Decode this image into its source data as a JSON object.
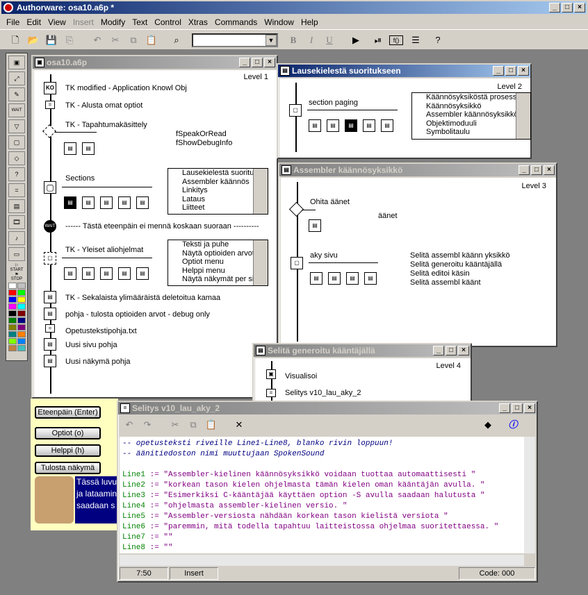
{
  "app": {
    "title": "Authorware: osa10.a6p *"
  },
  "menu": [
    "File",
    "Edit",
    "View",
    "Insert",
    "Modify",
    "Text",
    "Control",
    "Xtras",
    "Commands",
    "Window",
    "Help"
  ],
  "toolbar": {
    "font_select": "",
    "bold": "B",
    "italic": "I",
    "underline": "U"
  },
  "palette": {
    "start_label": "START",
    "stop_label": "STOP",
    "colors": [
      "#ffffff",
      "#c0c0c0",
      "#ff0000",
      "#00ff00",
      "#0000ff",
      "#ffff00",
      "#ff00ff",
      "#00ffff",
      "#000000",
      "#800000",
      "#008000",
      "#000080",
      "#808000",
      "#800080",
      "#008080",
      "#ff8000",
      "#80ff00",
      "#0080ff",
      "#c08040",
      "#40c0c0"
    ]
  },
  "win_main": {
    "title": "osa10.a6p",
    "level": "Level 1",
    "nodes": [
      "TK modified - Application Knowl Obj",
      "TK - Alusta omat optiot",
      "TK - Tapahtumakäsittely",
      "Sections",
      "------ Tästä eteenpäin ei mennä koskaan suoraan ----------",
      "TK - Yleiset aliohjelmat",
      "TK - Sekalaista ylimääräistä deletoitua kamaa",
      "pohja - tulosta optioiden arvot - debug only",
      "Opetustekstipohja.txt",
      "Uusi sivu pohja",
      "Uusi näkymä pohja"
    ],
    "funcs": [
      "fSpeakOrRead",
      "fShowDebugInfo"
    ],
    "list1": [
      "Lausekielestä suorituksee",
      "Assembler käännös",
      "Linkitys",
      "Lataus",
      "Liitteet"
    ],
    "list2": [
      "Teksti ja puhe",
      "Näytä optioiden arvot",
      "Optiot menu",
      "Helppi menu",
      "Näytä näkymät per sivu"
    ]
  },
  "win_l2": {
    "title": "Lausekielestä suoritukseen",
    "level": "Level 2",
    "node": "section paging",
    "list": [
      "Käännösyksiköstä prosessiin",
      "Käännösyksikkö",
      "Assembler käännösyksikkö",
      "Objektimoduuli",
      "Symbolitaulu"
    ]
  },
  "win_l3": {
    "title": "Assembler käännösyksikkö",
    "level": "Level 3",
    "nodes": [
      "Ohita äänet",
      "äänet",
      "aky sivu"
    ],
    "list": [
      "Selitä assembl käänn yksikkö",
      "Selitä generoitu kääntäjällä",
      "Selitä editoi käsin",
      "Selitä assembl käänt"
    ]
  },
  "win_l4": {
    "title": "Selitä generoitu kääntäjällä",
    "level": "Level 4",
    "nodes": [
      "Visualisoi",
      "Selitys v10_lau_aky_2"
    ]
  },
  "presentation": {
    "buttons": [
      "Eteenpäin (Enter)",
      "Optiot (o)",
      "Helppi (h)",
      "Tulosta näkymä"
    ],
    "text": [
      "Tässä luvu",
      "ja lataamin",
      "saadaan s"
    ]
  },
  "win_code": {
    "title": "Selitys v10_lau_aky_2",
    "lines": [
      {
        "t": "cmt",
        "s": "-- opetusteksti riveille Line1-Line8, blanko rivin loppuun!"
      },
      {
        "t": "cmt",
        "s": "-- äänitiedoston nimi muuttujaan SpokenSound"
      },
      {
        "t": "blank",
        "s": ""
      },
      {
        "t": "asg",
        "v": "Line1",
        "s": " := \"Assembler-kielinen käännösyksikkö voidaan tuottaa automaattisesti \""
      },
      {
        "t": "asg",
        "v": "Line2",
        "s": " := \"korkean tason kielen ohjelmasta tämän kielen oman kääntäjän avulla. \""
      },
      {
        "t": "asg",
        "v": "Line3",
        "s": " := \"Esimerkiksi C-kääntäjää käyttäen option -S avulla saadaan halutusta \""
      },
      {
        "t": "asg",
        "v": "Line4",
        "s": " := \"ohjelmasta assembler-kielinen versio. \""
      },
      {
        "t": "asg",
        "v": "Line5",
        "s": " := \"Assembler-versiosta nähdään korkean tason kielistä versiota \""
      },
      {
        "t": "asg",
        "v": "Line6",
        "s": " := \"paremmin, mitä todella tapahtuu laitteistossa ohjelmaa suoritettaessa. \""
      },
      {
        "t": "asg",
        "v": "Line7",
        "s": " := \"\""
      },
      {
        "t": "asg",
        "v": "Line8",
        "s": " := \"\""
      }
    ],
    "status": {
      "pos": "7:50",
      "mode": "Insert",
      "code": "Code: 000"
    }
  }
}
